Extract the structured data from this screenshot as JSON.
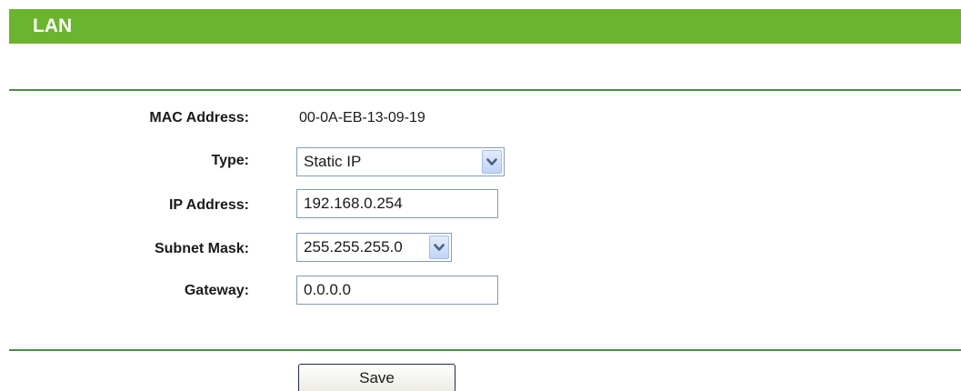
{
  "header": {
    "title": "LAN"
  },
  "form": {
    "mac": {
      "label": "MAC Address:",
      "value": "00-0A-EB-13-09-19"
    },
    "type": {
      "label": "Type:",
      "value": "Static IP"
    },
    "ip": {
      "label": "IP Address:",
      "value": "192.168.0.254"
    },
    "subnet": {
      "label": "Subnet Mask:",
      "value": "255.255.255.0"
    },
    "gateway": {
      "label": "Gateway:",
      "value": "0.0.0.0"
    }
  },
  "actions": {
    "save_label": "Save"
  },
  "colors": {
    "title_bar": "#6bb52e",
    "rule": "#4a8f45",
    "field_border": "#7f9db9"
  },
  "icons": {
    "dropdown": "chevron-down-icon"
  }
}
